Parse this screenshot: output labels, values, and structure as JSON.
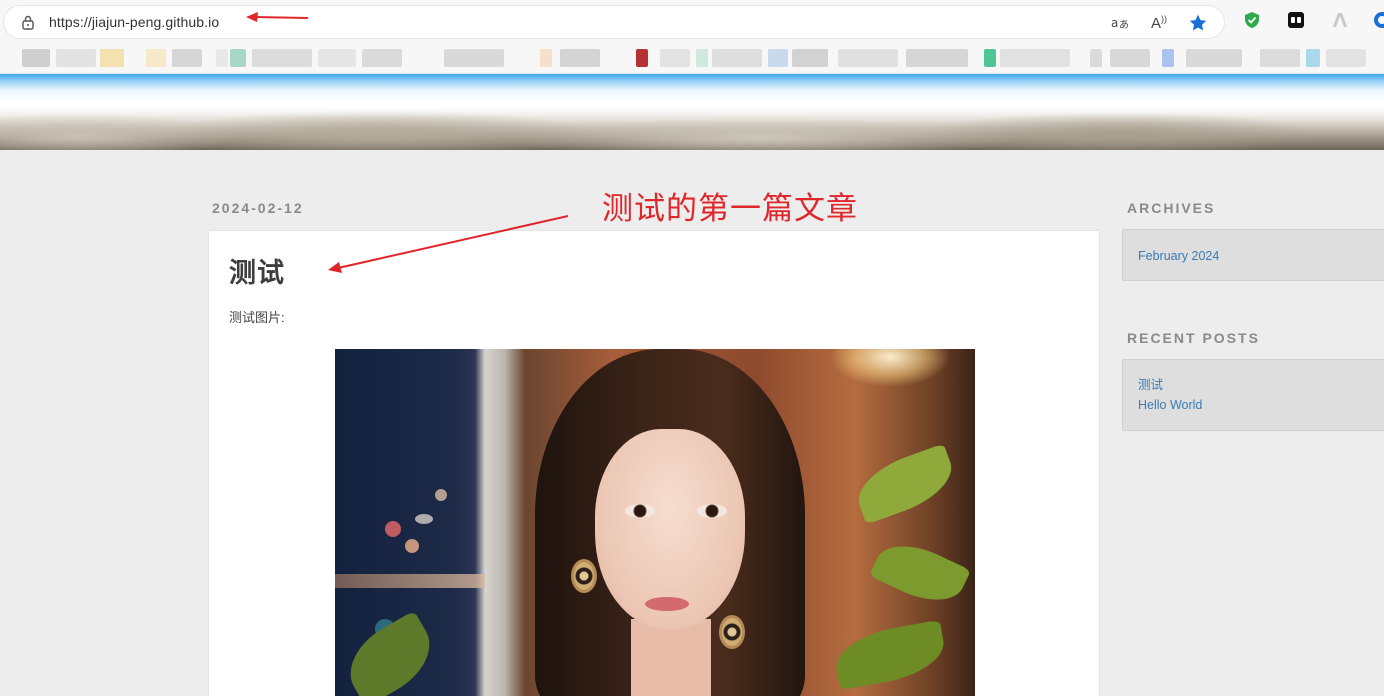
{
  "browser": {
    "url": "https://jiajun-peng.github.io",
    "read_aloud_label": "A",
    "icons": [
      "lock-icon",
      "translate-icon",
      "read-aloud-icon",
      "favorite-star-icon",
      "shield-extension-icon",
      "game-extension-icon",
      "app-extension-icon",
      "profile-icon"
    ],
    "star_color": "#1a6ed8"
  },
  "post": {
    "date": "2024-02-12",
    "title": "测试",
    "body": "测试图片:"
  },
  "annotation": {
    "text": "测试的第一篇文章",
    "color": "#e0262b"
  },
  "sidebar": {
    "archives_heading": "ARCHIVES",
    "archives": [
      {
        "label": "February 2024"
      }
    ],
    "recent_heading": "RECENT POSTS",
    "recent": [
      {
        "label": "测试"
      },
      {
        "label": "Hello World"
      }
    ]
  }
}
